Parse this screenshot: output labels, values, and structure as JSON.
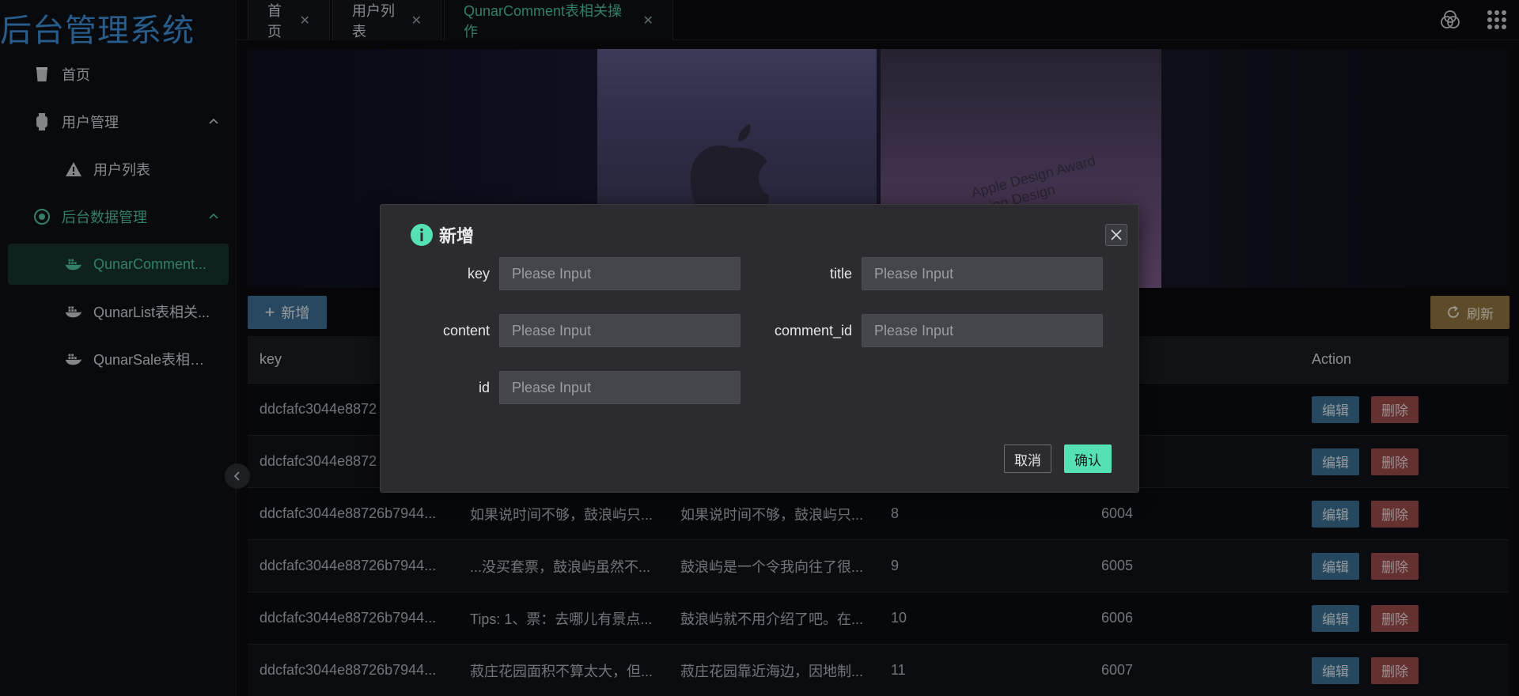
{
  "app": {
    "title": "后台管理系统"
  },
  "sidebar": {
    "items": [
      {
        "label": "首页",
        "icon": "cup-icon"
      },
      {
        "label": "用户管理",
        "icon": "watch-icon"
      },
      {
        "label": "用户列表",
        "icon": "warning-icon"
      },
      {
        "label": "后台数据管理",
        "icon": "eye-icon"
      },
      {
        "label": "QunarComment...",
        "icon": "docker-icon"
      },
      {
        "label": "QunarList表相关...",
        "icon": "docker-icon"
      },
      {
        "label": "QunarSale表相关...",
        "icon": "docker-icon"
      }
    ]
  },
  "tabs": [
    {
      "label": "首页"
    },
    {
      "label": "用户列表"
    },
    {
      "label": "QunarComment表相关操作"
    }
  ],
  "banner": {
    "award_text": "Apple Design Award\n…ing Design"
  },
  "toolbar": {
    "add_label": "新增",
    "refresh_label": "刷新"
  },
  "table": {
    "headers": [
      "key",
      "",
      "",
      "",
      "",
      "Action"
    ],
    "rows": [
      [
        "ddcfafc3044e8872",
        "",
        "",
        "",
        ""
      ],
      [
        "ddcfafc3044e8872",
        "",
        "",
        "",
        ""
      ],
      [
        "ddcfafc3044e88726b7944...",
        "如果说时间不够，鼓浪屿只...",
        "如果说时间不够，鼓浪屿只...",
        "8",
        "6004"
      ],
      [
        "ddcfafc3044e88726b7944...",
        "...没买套票，鼓浪屿虽然不...",
        "鼓浪屿是一个令我向往了很...",
        "9",
        "6005"
      ],
      [
        "ddcfafc3044e88726b7944...",
        "Tips: 1、票：去哪儿有景点...",
        "鼓浪屿就不用介绍了吧。在...",
        "10",
        "6006"
      ],
      [
        "ddcfafc3044e88726b7944...",
        "菽庄花园面积不算太大，但...",
        "菽庄花园靠近海边，因地制...",
        "11",
        "6007"
      ]
    ],
    "edit_label": "编辑",
    "delete_label": "删除"
  },
  "dialog": {
    "title": "新增",
    "fields": {
      "key": {
        "label": "key",
        "placeholder": "Please Input"
      },
      "title": {
        "label": "title",
        "placeholder": "Please Input"
      },
      "content": {
        "label": "content",
        "placeholder": "Please Input"
      },
      "comment_id": {
        "label": "comment_id",
        "placeholder": "Please Input"
      },
      "id": {
        "label": "id",
        "placeholder": "Please Input"
      }
    },
    "cancel_label": "取消",
    "confirm_label": "确认"
  },
  "colors": {
    "accent": "#4fc2a0",
    "primary": "#3d6f94",
    "danger": "#9a4a4a",
    "warning": "#8f7440",
    "confirm": "#55e0b6"
  }
}
